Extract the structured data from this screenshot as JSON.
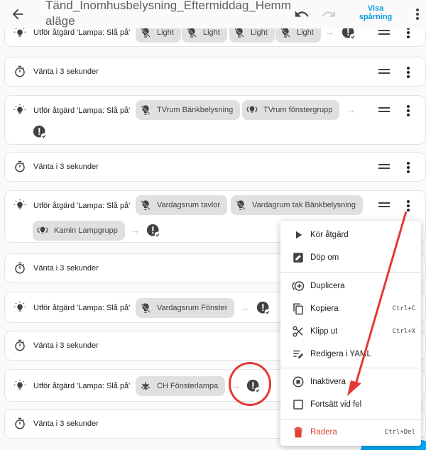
{
  "header": {
    "title": "Tänd_Inomhusbelysning_Eftermiddag_Hemmaläge",
    "trace_button": "Visa spårning",
    "icons": [
      "back-arrow-icon",
      "undo-icon",
      "redo-icon",
      "more-vertical-icon"
    ]
  },
  "rows": [
    {
      "type": "action",
      "text": "Utför åtgärd 'Lampa: Slå på'",
      "chips": [
        {
          "label": "Light",
          "icon": "lightbulb-off-icon"
        },
        {
          "label": "Light",
          "icon": "lightbulb-off-icon"
        },
        {
          "label": "Light",
          "icon": "lightbulb-off-icon"
        },
        {
          "label": "Light",
          "icon": "lightbulb-off-icon"
        }
      ]
    },
    {
      "type": "delay",
      "text": "Vänta i 3 sekunder"
    },
    {
      "type": "action",
      "text": "Utför åtgärd 'Lampa: Slå på'",
      "chips": [
        {
          "label": "TVrum Bänkbelysning",
          "icon": "lightbulb-off-icon"
        },
        {
          "label": "TVrum fönstergrupp",
          "icon": "lightbulb-group-icon"
        }
      ]
    },
    {
      "type": "delay",
      "text": "Vänta i 3 sekunder"
    },
    {
      "type": "action",
      "text": "Utför åtgärd 'Lampa: Slå på'",
      "chips": [
        {
          "label": "Vardagsrum tavlor",
          "icon": "lightbulb-off-icon"
        },
        {
          "label": "Vardagrum tak Bänkbelysning",
          "icon": "lightbulb-off-icon"
        },
        {
          "label": "Kamin Lampgrupp",
          "icon": "lightbulb-group-icon"
        }
      ]
    },
    {
      "type": "delay",
      "text": "Vänta i 3 sekunder"
    },
    {
      "type": "action",
      "text": "Utför åtgärd 'Lampa: Slå på'",
      "chips": [
        {
          "label": "Vardagsrum Fönster",
          "icon": "lightbulb-off-icon"
        }
      ]
    },
    {
      "type": "delay",
      "text": "Vänta i 3 sekunder"
    },
    {
      "type": "action",
      "text": "Utför åtgärd 'Lampa: Slå på'",
      "chips": [
        {
          "label": "CH Fönsterlampa",
          "icon": "ceiling-light-icon"
        }
      ]
    },
    {
      "type": "delay",
      "text": "Vänta i 3 sekunder"
    }
  ],
  "menu": {
    "items": [
      {
        "label": "Kör åtgärd",
        "icon": "play-icon",
        "shortcut": ""
      },
      {
        "label": "Döp om",
        "icon": "rename-icon",
        "shortcut": ""
      },
      {
        "label": "Duplicera",
        "icon": "duplicate-icon",
        "shortcut": ""
      },
      {
        "label": "Kopiera",
        "icon": "copy-icon",
        "shortcut": "Ctrl+C"
      },
      {
        "label": "Klipp ut",
        "icon": "cut-icon",
        "shortcut": "Ctrl+X"
      },
      {
        "label": "Redigera i YAML",
        "icon": "yaml-edit-icon",
        "shortcut": ""
      },
      {
        "label": "Inaktivera",
        "icon": "disable-icon",
        "shortcut": ""
      },
      {
        "label": "Fortsätt vid fel",
        "icon": "checkbox-icon",
        "shortcut": ""
      },
      {
        "label": "Radera",
        "icon": "delete-icon",
        "shortcut": "Ctrl+Del"
      }
    ],
    "delete_color": "#db4437"
  },
  "colors": {
    "accent": "#039be5",
    "annotation": "#e53935"
  }
}
